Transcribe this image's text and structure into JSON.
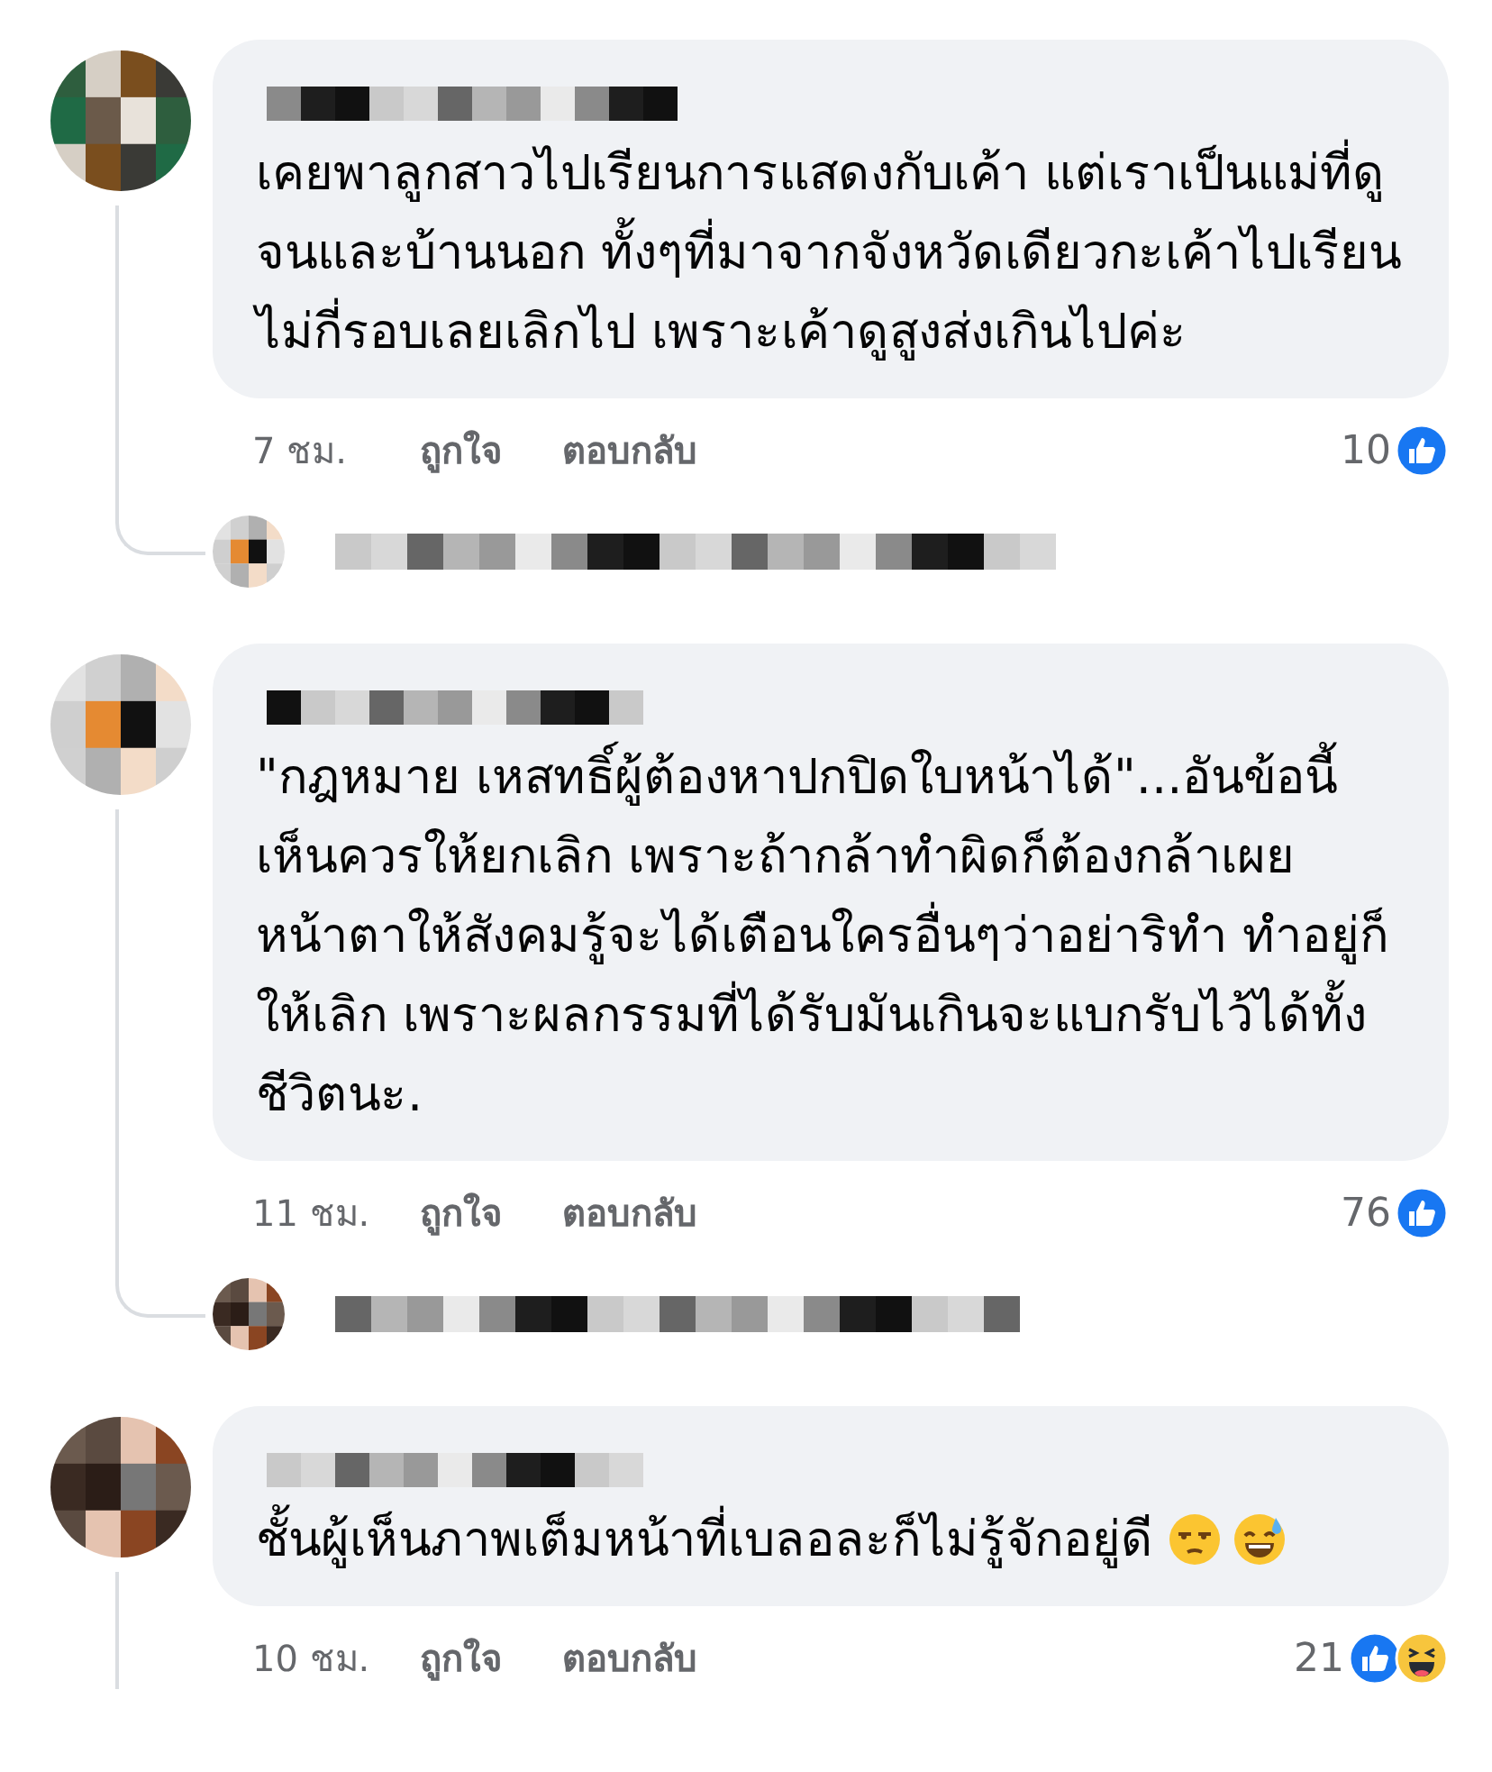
{
  "comments": [
    {
      "text": "เคยพาลูกสาวไปเรียนการแสดงกับเค้า  แต่เราเป็นแม่ที่ดูจนและบ้านนอก ทั้งๆที่มาจากจังหวัดเดียวกะเค้าไปเรียนไม่กี่รอบเลยเลิกไป เพราะเค้าดูสูงส่งเกินไปค่ะ",
      "time": "7 ชม.",
      "like_label": "ถูกใจ",
      "reply_label": "ตอบกลับ",
      "reaction_count": "10",
      "reactions": [
        {
          "kind": "like"
        }
      ],
      "reply_preview": true
    },
    {
      "text": "\"กฎหมาย เหสทธิ์ผู้ต้องหาปกปิดใบหน้าได้\"...อันข้อนี้เห็นควรให้ยกเลิก เพราะถ้ากล้าทำผิดก็ต้องกล้าเผยหน้าตาให้สังคมรู้จะได้เตือนใครอื่นๆว่าอย่าริทำ ทำอยู่ก็ให้เลิก เพราะผลกรรมที่ได้รับมันเกินจะแบกรับไว้ได้ทั้งชีวิตนะ.",
      "time": "11 ชม.",
      "like_label": "ถูกใจ",
      "reply_label": "ตอบกลับ",
      "reaction_count": "76",
      "reactions": [
        {
          "kind": "like"
        }
      ],
      "reply_preview": true
    },
    {
      "text": "ชั้นผู้เห็นภาพเต็มหน้าที่เบลอละก็ไม่รู้จักอยู่ดี",
      "emojis": [
        {
          "kind": "unamused"
        },
        {
          "kind": "sweat-smile"
        }
      ],
      "time": "10 ชม.",
      "like_label": "ถูกใจ",
      "reply_label": "ตอบกลับ",
      "reaction_count": "21",
      "reactions": [
        {
          "kind": "like"
        },
        {
          "kind": "haha"
        }
      ],
      "reply_preview": false
    }
  ]
}
